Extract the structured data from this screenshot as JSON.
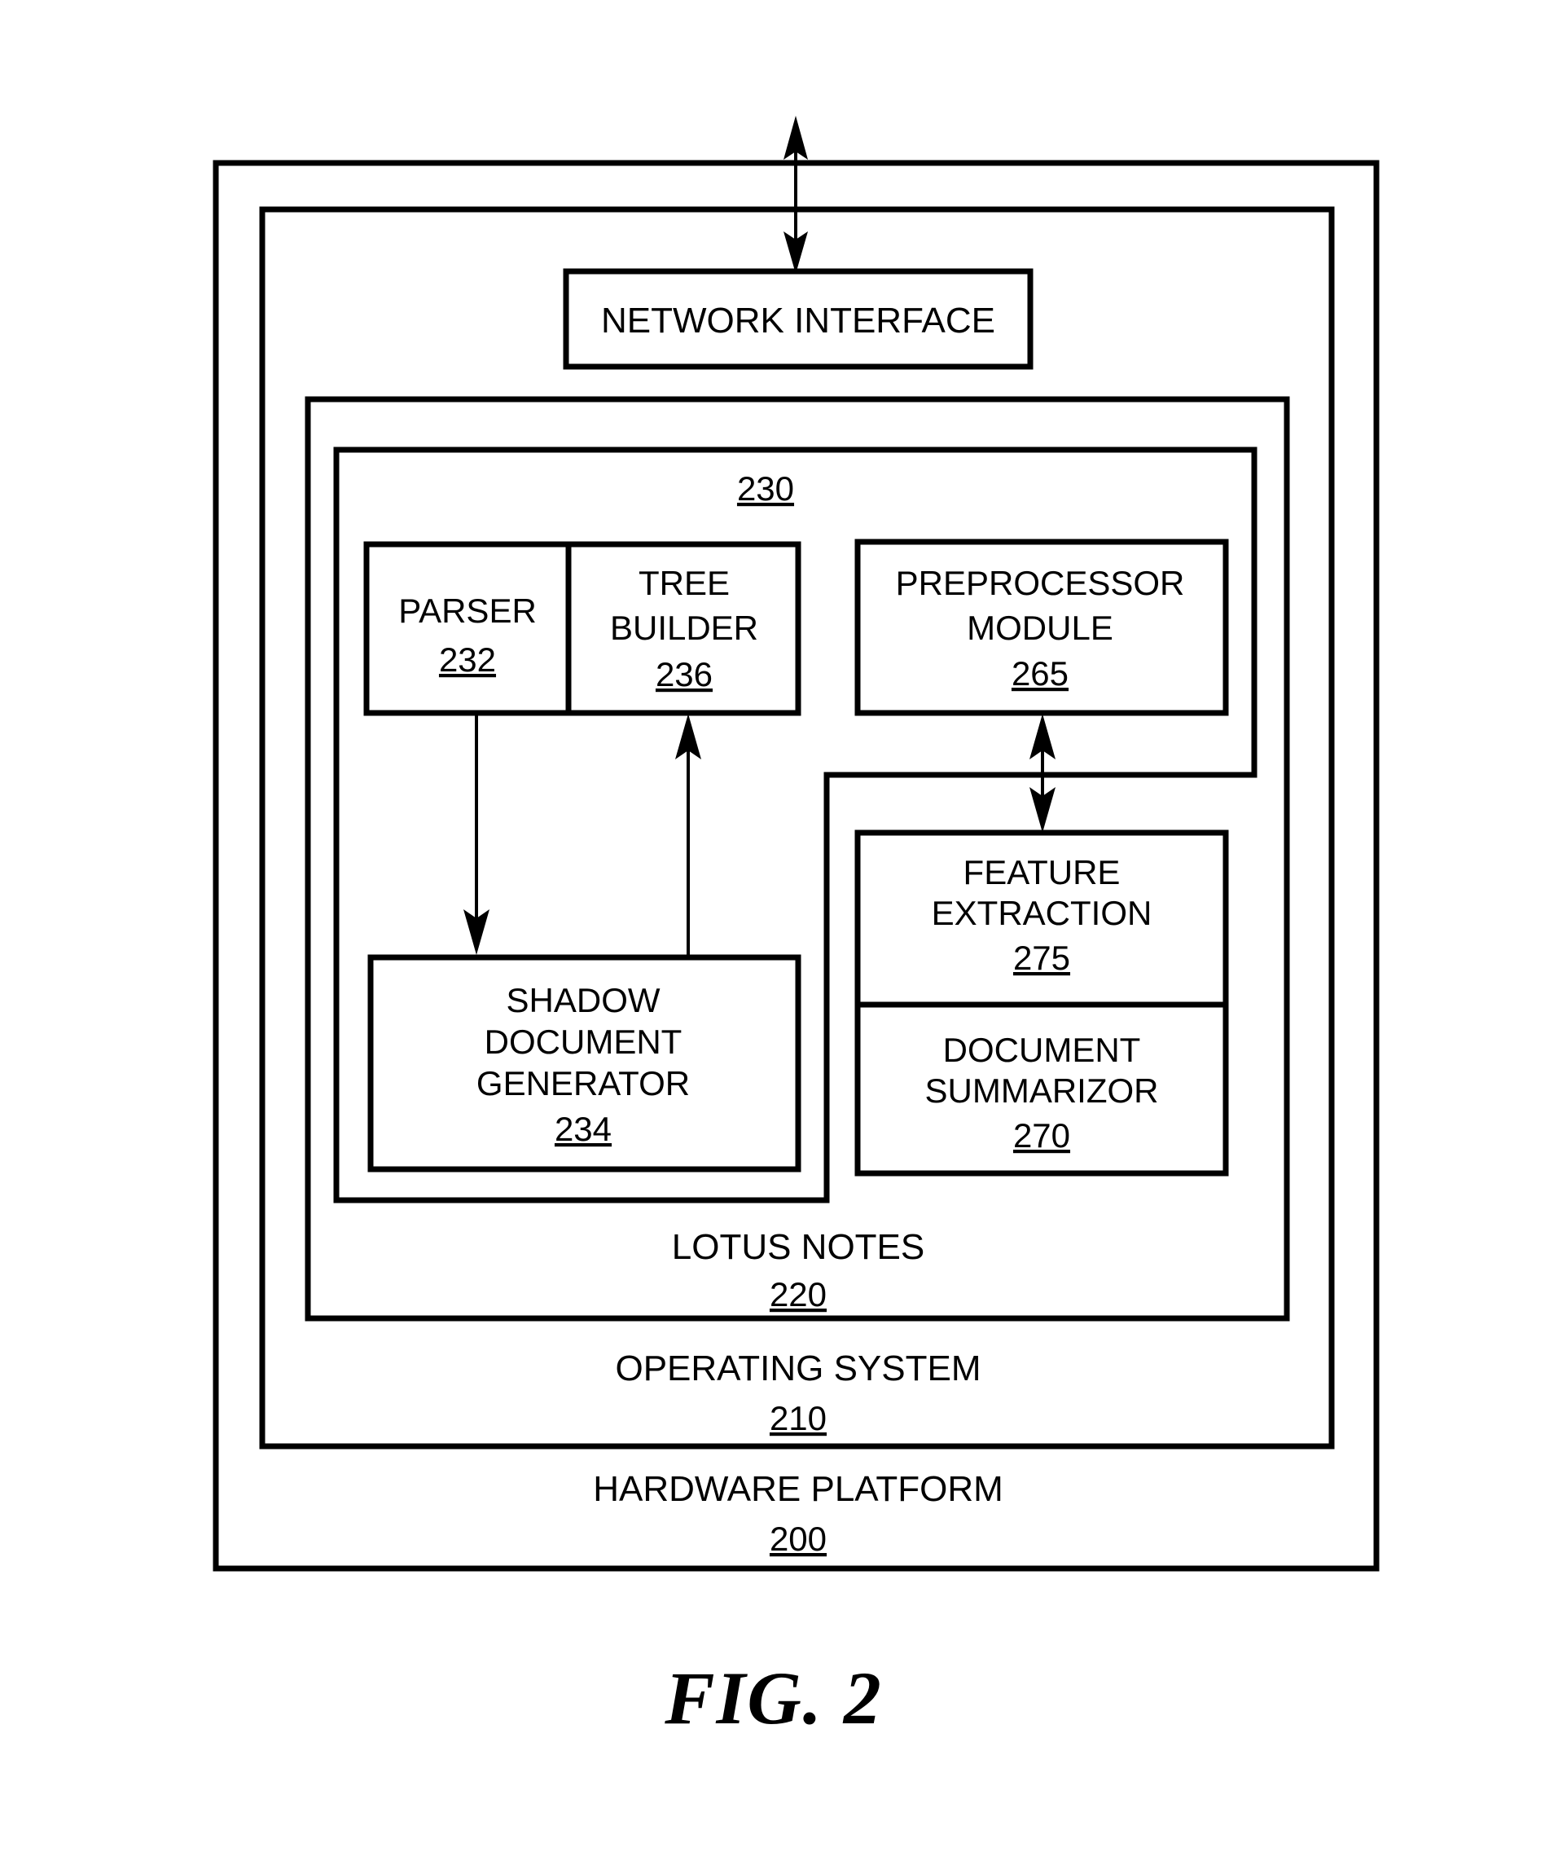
{
  "figure": {
    "caption": "FIG. 2",
    "type": "patent-block-diagram"
  },
  "layers": {
    "hardware_platform": {
      "label": "HARDWARE PLATFORM",
      "ref": "200"
    },
    "operating_system": {
      "label": "OPERATING SYSTEM",
      "ref": "210"
    },
    "lotus_notes": {
      "label": "LOTUS NOTES",
      "ref": "220"
    },
    "inner_module": {
      "label": "",
      "ref": "230"
    }
  },
  "blocks": {
    "network_interface": {
      "label": "NETWORK INTERFACE",
      "ref": ""
    },
    "parser": {
      "label": "PARSER",
      "ref": "232"
    },
    "tree_builder": {
      "line1": "TREE",
      "line2": "BUILDER",
      "ref": "236"
    },
    "preprocessor_module": {
      "line1": "PREPROCESSOR",
      "line2": "MODULE",
      "ref": "265"
    },
    "shadow_document_generator": {
      "line1": "SHADOW",
      "line2": "DOCUMENT",
      "line3": "GENERATOR",
      "ref": "234"
    },
    "feature_extraction": {
      "line1": "FEATURE",
      "line2": "EXTRACTION",
      "ref": "275"
    },
    "document_summarizor": {
      "line1": "DOCUMENT",
      "line2": "SUMMARIZOR",
      "ref": "270"
    }
  },
  "connectors": {
    "network_external": "bidirectional arrow between network interface and external network",
    "parser_to_shadow": "arrow from parser down to shadow document generator",
    "shadow_to_tree": "arrow from shadow document generator up to tree builder",
    "preprocessor_to_feature": "bidirectional arrow between preprocessor module and feature extraction"
  },
  "colors": {
    "stroke": "#000000",
    "background": "#ffffff"
  }
}
